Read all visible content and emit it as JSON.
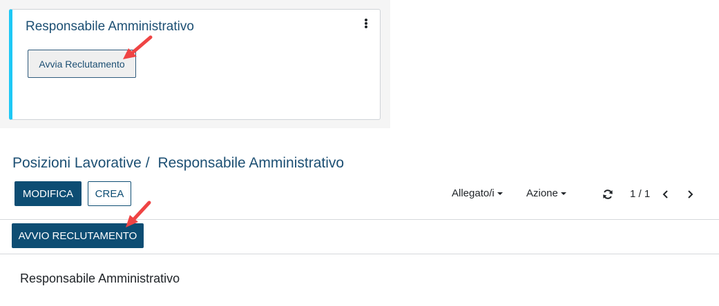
{
  "kanban_card": {
    "title": "Responsabile Amministrativo",
    "action_button": "Avvia Reclutamento"
  },
  "breadcrumb": {
    "parent": "Posizioni Lavorative",
    "separator": "/",
    "current": "Responsabile Amministrativo"
  },
  "toolbar": {
    "edit_label": "MODIFICA",
    "create_label": "CREA",
    "attachments_label": "Allegato/i",
    "action_label": "Azione",
    "pager": "1 / 1"
  },
  "statusbar": {
    "start_recruitment_label": "AVVIO RECLUTAMENTO"
  },
  "record": {
    "name": "Responsabile Amministrativo"
  },
  "colors": {
    "primary": "#0d4d73",
    "card_accent": "#1ec8f5",
    "annotation_arrow": "#ef4444"
  }
}
